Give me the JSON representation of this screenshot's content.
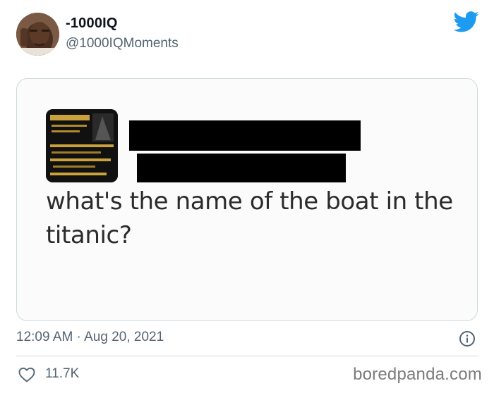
{
  "author": {
    "display_name": "-1000IQ",
    "handle": "@1000IQMoments",
    "avatar_icon": "avatar-face-image",
    "platform_icon": "twitter-bird-icon"
  },
  "media": {
    "question_text": "what's the name of the boat in the titanic?",
    "thumbnail_icon": "first-class-ticket-image",
    "redacted_name_bars": 2
  },
  "meta": {
    "timestamp": "12:09 AM · Aug 20, 2021",
    "info_icon": "info-icon"
  },
  "engagement": {
    "like_icon": "heart-icon",
    "likes": "11.7K"
  },
  "watermark": {
    "text": "boredpanda.com"
  },
  "colors": {
    "twitter_blue": "#1d9bf0",
    "secondary_text": "#536471",
    "border": "#cfd9de"
  }
}
